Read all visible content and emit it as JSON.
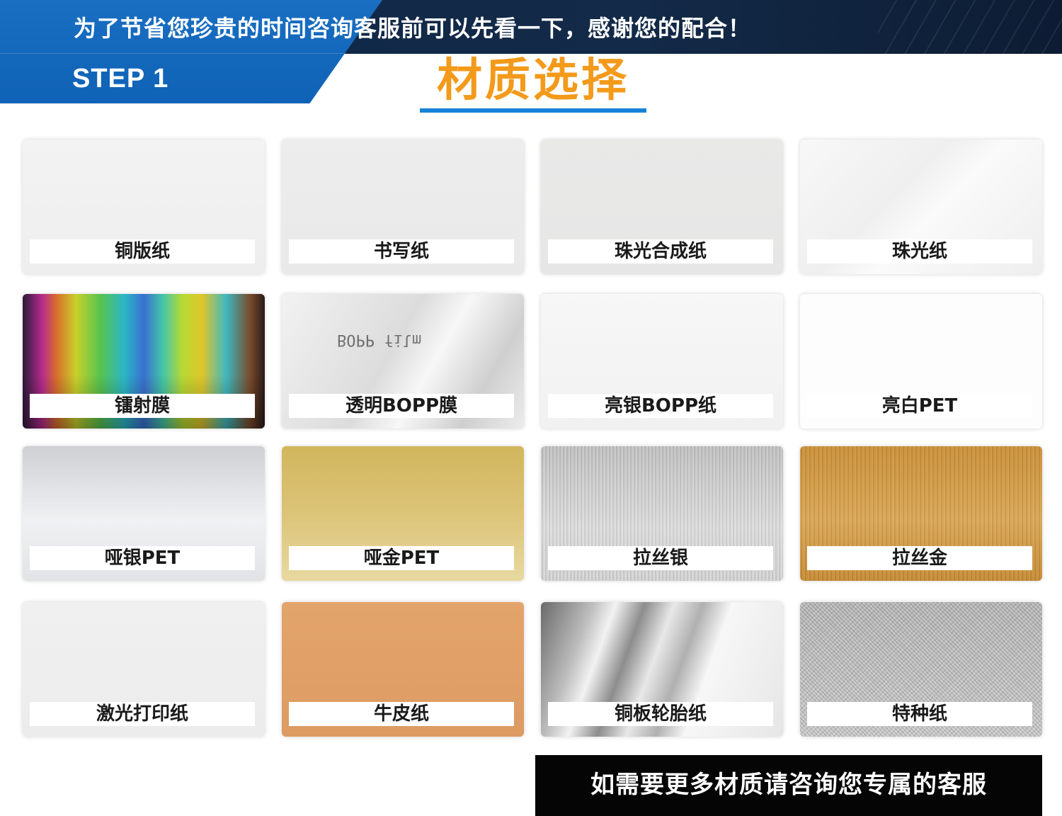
{
  "header": {
    "notice": "为了节省您珍贵的时间咨询客服前可以先看一下，感谢您的配合！",
    "step": "STEP 1",
    "section_title": "材质选择"
  },
  "materials": [
    {
      "label": "铜版纸",
      "texture": "coated-paper"
    },
    {
      "label": "书写纸",
      "texture": "writing-paper"
    },
    {
      "label": "珠光合成纸",
      "texture": "pearl-synthetic-paper"
    },
    {
      "label": "珠光纸",
      "texture": "pearl-paper"
    },
    {
      "label": "镭射膜",
      "texture": "laser-film"
    },
    {
      "label": "透明BOPP膜",
      "texture": "clear-bopp-film",
      "film_print": "BOPP film"
    },
    {
      "label": "亮银BOPP纸",
      "texture": "bright-silver-bopp"
    },
    {
      "label": "亮白PET",
      "texture": "bright-white-pet"
    },
    {
      "label": "哑银PET",
      "texture": "matte-silver-pet"
    },
    {
      "label": "哑金PET",
      "texture": "matte-gold-pet"
    },
    {
      "label": "拉丝银",
      "texture": "brushed-silver"
    },
    {
      "label": "拉丝金",
      "texture": "brushed-gold"
    },
    {
      "label": "激光打印纸",
      "texture": "laser-print-paper"
    },
    {
      "label": "牛皮纸",
      "texture": "kraft-paper"
    },
    {
      "label": "铜板轮胎纸",
      "texture": "coated-tire-paper"
    },
    {
      "label": "特种纸",
      "texture": "special-paper"
    }
  ],
  "cta": {
    "text": "如需要更多材质请咨询您专属的客服"
  },
  "colors": {
    "header_dark": "#132a48",
    "header_blue": "#0f62b5",
    "title_orange": "#f39a1b",
    "underline_blue": "#1683d8",
    "cta_background": "#050505"
  }
}
